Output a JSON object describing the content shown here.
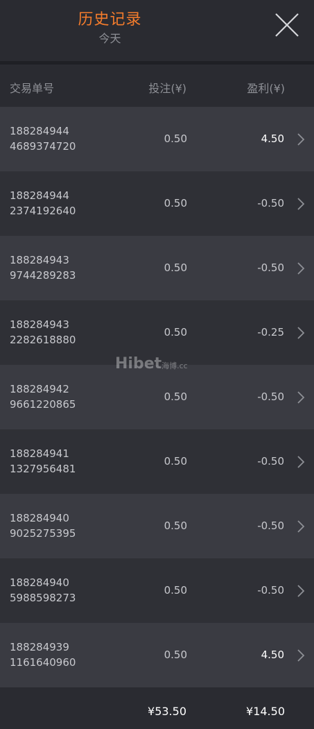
{
  "header": {
    "title": "历史记录",
    "subtitle": "今天"
  },
  "columns": {
    "id": "交易单号",
    "bet": "投注(¥)",
    "profit": "盈利(¥)"
  },
  "rows": [
    {
      "id_line1": "188284944",
      "id_line2": "4689374720",
      "bet": "0.50",
      "profit": "4.50"
    },
    {
      "id_line1": "188284944",
      "id_line2": "2374192640",
      "bet": "0.50",
      "profit": "-0.50"
    },
    {
      "id_line1": "188284943",
      "id_line2": "9744289283",
      "bet": "0.50",
      "profit": "-0.50"
    },
    {
      "id_line1": "188284943",
      "id_line2": "2282618880",
      "bet": "0.50",
      "profit": "-0.25"
    },
    {
      "id_line1": "188284942",
      "id_line2": "9661220865",
      "bet": "0.50",
      "profit": "-0.50"
    },
    {
      "id_line1": "188284941",
      "id_line2": "1327956481",
      "bet": "0.50",
      "profit": "-0.50"
    },
    {
      "id_line1": "188284940",
      "id_line2": "9025275395",
      "bet": "0.50",
      "profit": "-0.50"
    },
    {
      "id_line1": "188284940",
      "id_line2": "5988598273",
      "bet": "0.50",
      "profit": "-0.50"
    },
    {
      "id_line1": "188284939",
      "id_line2": "1161640960",
      "bet": "0.50",
      "profit": "4.50"
    }
  ],
  "totals": {
    "bet": "¥53.50",
    "profit": "¥14.50"
  },
  "watermark": {
    "text": "Hibet",
    "suffix": "海博.cc"
  },
  "icons": {
    "close": "close-icon",
    "row_arrow": "chevron-right-icon"
  },
  "colors": {
    "accent": "#f47c2c",
    "background": "#2a2b31",
    "row_odd": "#3a3b42",
    "row_even": "#2f3036"
  }
}
